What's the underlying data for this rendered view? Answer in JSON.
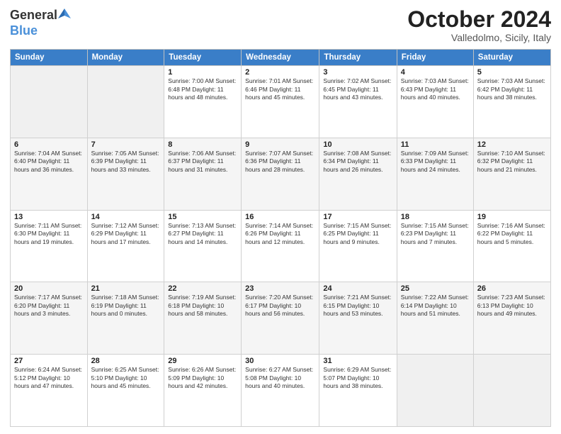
{
  "header": {
    "logo_general": "General",
    "logo_blue": "Blue",
    "title": "October 2024",
    "subtitle": "Valledolmo, Sicily, Italy"
  },
  "weekdays": [
    "Sunday",
    "Monday",
    "Tuesday",
    "Wednesday",
    "Thursday",
    "Friday",
    "Saturday"
  ],
  "weeks": [
    [
      {
        "day": "",
        "info": ""
      },
      {
        "day": "",
        "info": ""
      },
      {
        "day": "1",
        "info": "Sunrise: 7:00 AM\nSunset: 6:48 PM\nDaylight: 11 hours and 48 minutes."
      },
      {
        "day": "2",
        "info": "Sunrise: 7:01 AM\nSunset: 6:46 PM\nDaylight: 11 hours and 45 minutes."
      },
      {
        "day": "3",
        "info": "Sunrise: 7:02 AM\nSunset: 6:45 PM\nDaylight: 11 hours and 43 minutes."
      },
      {
        "day": "4",
        "info": "Sunrise: 7:03 AM\nSunset: 6:43 PM\nDaylight: 11 hours and 40 minutes."
      },
      {
        "day": "5",
        "info": "Sunrise: 7:03 AM\nSunset: 6:42 PM\nDaylight: 11 hours and 38 minutes."
      }
    ],
    [
      {
        "day": "6",
        "info": "Sunrise: 7:04 AM\nSunset: 6:40 PM\nDaylight: 11 hours and 36 minutes."
      },
      {
        "day": "7",
        "info": "Sunrise: 7:05 AM\nSunset: 6:39 PM\nDaylight: 11 hours and 33 minutes."
      },
      {
        "day": "8",
        "info": "Sunrise: 7:06 AM\nSunset: 6:37 PM\nDaylight: 11 hours and 31 minutes."
      },
      {
        "day": "9",
        "info": "Sunrise: 7:07 AM\nSunset: 6:36 PM\nDaylight: 11 hours and 28 minutes."
      },
      {
        "day": "10",
        "info": "Sunrise: 7:08 AM\nSunset: 6:34 PM\nDaylight: 11 hours and 26 minutes."
      },
      {
        "day": "11",
        "info": "Sunrise: 7:09 AM\nSunset: 6:33 PM\nDaylight: 11 hours and 24 minutes."
      },
      {
        "day": "12",
        "info": "Sunrise: 7:10 AM\nSunset: 6:32 PM\nDaylight: 11 hours and 21 minutes."
      }
    ],
    [
      {
        "day": "13",
        "info": "Sunrise: 7:11 AM\nSunset: 6:30 PM\nDaylight: 11 hours and 19 minutes."
      },
      {
        "day": "14",
        "info": "Sunrise: 7:12 AM\nSunset: 6:29 PM\nDaylight: 11 hours and 17 minutes."
      },
      {
        "day": "15",
        "info": "Sunrise: 7:13 AM\nSunset: 6:27 PM\nDaylight: 11 hours and 14 minutes."
      },
      {
        "day": "16",
        "info": "Sunrise: 7:14 AM\nSunset: 6:26 PM\nDaylight: 11 hours and 12 minutes."
      },
      {
        "day": "17",
        "info": "Sunrise: 7:15 AM\nSunset: 6:25 PM\nDaylight: 11 hours and 9 minutes."
      },
      {
        "day": "18",
        "info": "Sunrise: 7:15 AM\nSunset: 6:23 PM\nDaylight: 11 hours and 7 minutes."
      },
      {
        "day": "19",
        "info": "Sunrise: 7:16 AM\nSunset: 6:22 PM\nDaylight: 11 hours and 5 minutes."
      }
    ],
    [
      {
        "day": "20",
        "info": "Sunrise: 7:17 AM\nSunset: 6:20 PM\nDaylight: 11 hours and 3 minutes."
      },
      {
        "day": "21",
        "info": "Sunrise: 7:18 AM\nSunset: 6:19 PM\nDaylight: 11 hours and 0 minutes."
      },
      {
        "day": "22",
        "info": "Sunrise: 7:19 AM\nSunset: 6:18 PM\nDaylight: 10 hours and 58 minutes."
      },
      {
        "day": "23",
        "info": "Sunrise: 7:20 AM\nSunset: 6:17 PM\nDaylight: 10 hours and 56 minutes."
      },
      {
        "day": "24",
        "info": "Sunrise: 7:21 AM\nSunset: 6:15 PM\nDaylight: 10 hours and 53 minutes."
      },
      {
        "day": "25",
        "info": "Sunrise: 7:22 AM\nSunset: 6:14 PM\nDaylight: 10 hours and 51 minutes."
      },
      {
        "day": "26",
        "info": "Sunrise: 7:23 AM\nSunset: 6:13 PM\nDaylight: 10 hours and 49 minutes."
      }
    ],
    [
      {
        "day": "27",
        "info": "Sunrise: 6:24 AM\nSunset: 5:12 PM\nDaylight: 10 hours and 47 minutes."
      },
      {
        "day": "28",
        "info": "Sunrise: 6:25 AM\nSunset: 5:10 PM\nDaylight: 10 hours and 45 minutes."
      },
      {
        "day": "29",
        "info": "Sunrise: 6:26 AM\nSunset: 5:09 PM\nDaylight: 10 hours and 42 minutes."
      },
      {
        "day": "30",
        "info": "Sunrise: 6:27 AM\nSunset: 5:08 PM\nDaylight: 10 hours and 40 minutes."
      },
      {
        "day": "31",
        "info": "Sunrise: 6:29 AM\nSunset: 5:07 PM\nDaylight: 10 hours and 38 minutes."
      },
      {
        "day": "",
        "info": ""
      },
      {
        "day": "",
        "info": ""
      }
    ]
  ]
}
